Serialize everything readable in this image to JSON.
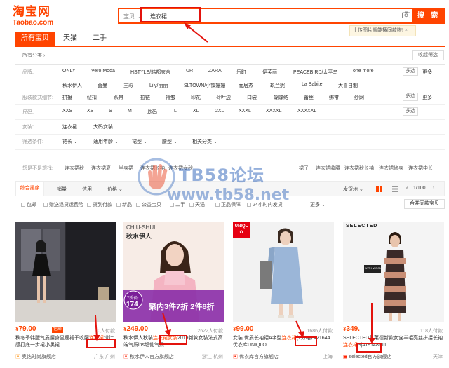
{
  "logo": {
    "cn": "淘宝网",
    "en": "Taobao.com"
  },
  "search": {
    "scope": "宝贝",
    "value": "连衣裙",
    "button": "搜 索",
    "image_tip": "上传图片就能搜同款啦!"
  },
  "tabs": [
    "所有宝贝",
    "天猫",
    "二手"
  ],
  "breadcrumb": "所有分类",
  "collapse": "收起筛选",
  "filters": [
    {
      "label": "品牌:",
      "values": [
        "ONLY",
        "Vero Moda",
        "HSTYLE/韩都衣舍",
        "UR",
        "ZARA",
        "乐町",
        "伊芙丽",
        "PEACEBIRD/太平鸟",
        "one more"
      ],
      "values2": [
        "秋水伊人",
        "茵曼",
        "三彩",
        "Lily/丽丽",
        "SLTOWN/小镇姗姗",
        "而居杰",
        "玖兰妮",
        "La Babite",
        "大喜自制"
      ],
      "multi": "多选",
      "more": "更多"
    },
    {
      "label": "服装款式细节:",
      "values": [
        "拼接",
        "纽扣",
        "系带",
        "拉链",
        "褶皱",
        "印花",
        "荷叶边",
        "口袋",
        "蝴蝶结",
        "蕾丝",
        "绑带",
        "纱网"
      ],
      "multi": "多选",
      "more": "更多"
    },
    {
      "label": "尺码:",
      "values": [
        "XXS",
        "XS",
        "S",
        "M",
        "均码",
        "L",
        "XL",
        "2XL",
        "XXXL",
        "XXXXL",
        "XXXXXL"
      ],
      "multi": "多选"
    },
    {
      "label": "女装:",
      "values": [
        "连衣裙",
        "大码女装"
      ]
    },
    {
      "label": "筛选条件:",
      "values": [
        "裙长",
        "适用年龄",
        "裙型",
        "腰型",
        "相关分类"
      ]
    }
  ],
  "related": {
    "label": "您是不是想找:",
    "tags": [
      "连衣裙秋",
      "连衣裙夏",
      "半身裙",
      "连衣裙长袖",
      "连衣裙女秋",
      "",
      "",
      "",
      "",
      "裙子",
      "连衣裙收腰",
      "连衣裙秋长袖",
      "连衣裙修身",
      "连衣裙中长"
    ]
  },
  "sort": {
    "items": [
      "综合排序",
      "销量",
      "信用",
      "价格"
    ],
    "location": "发货地",
    "page": "1/100"
  },
  "options": [
    "包邮",
    "赠送退货运费险",
    "货到付款",
    "新品",
    "公益宝贝",
    "二手",
    "天猫",
    "正品保障",
    "24小时内发货",
    "",
    "更多"
  ],
  "merge": "合并同款宝贝",
  "products": [
    {
      "price": "79.00",
      "badge": "包邮",
      "sales": "0人付款",
      "title_pre": "秋冬季韩版气质腰身显瘦裙子收腰",
      "title_hl": "连衣裙",
      "title_post": "设计感打底一步裙小黑裙",
      "shop": "奥钻时尚旗舰店",
      "location": "广东 广州"
    },
    {
      "price": "249.00",
      "sales": "2622人付款",
      "title_pre": "秋水伊人秋装",
      "title_hl": "连衣裙女装",
      "title_post": "2019新款女装法式高端气质ins超仙气质",
      "shop": "秋水伊人官方旗舰店",
      "location": "浙江 杭州",
      "brand": "CHIU·SHUI",
      "brand_cn": "秋水伊人",
      "promo": "聚内3件7折 2件8折",
      "disc": "7折价:",
      "disc_price": "174"
    },
    {
      "price": "99.00",
      "sales": "1686人付款",
      "title_pre": "女装 优质长袖褶A字型",
      "title_hl": "连衣裙",
      "title_post": "(7分袖) 421644 优衣库UNIQLO",
      "shop": "优衣库官方旗舰店",
      "location": "上海",
      "brand": "UNIQLO"
    },
    {
      "price": "349.",
      "sales": "118人付款",
      "title_pre": "SELECTED思莱德新款女含羊毛亮丝拼接长袖",
      "title_hl": "连衣裙",
      "title_post": "S|419148511",
      "shop": "selected官方旗舰店",
      "location": "天津",
      "brand": "SELECTED",
      "brand2": "WITH WOOL"
    }
  ],
  "watermark": {
    "text": "TB58论坛",
    "url": "www.tb58.net"
  },
  "colors": {
    "accent": "#ff4400",
    "annotation": "#e3130d",
    "watermark": "#3c6ebe"
  }
}
